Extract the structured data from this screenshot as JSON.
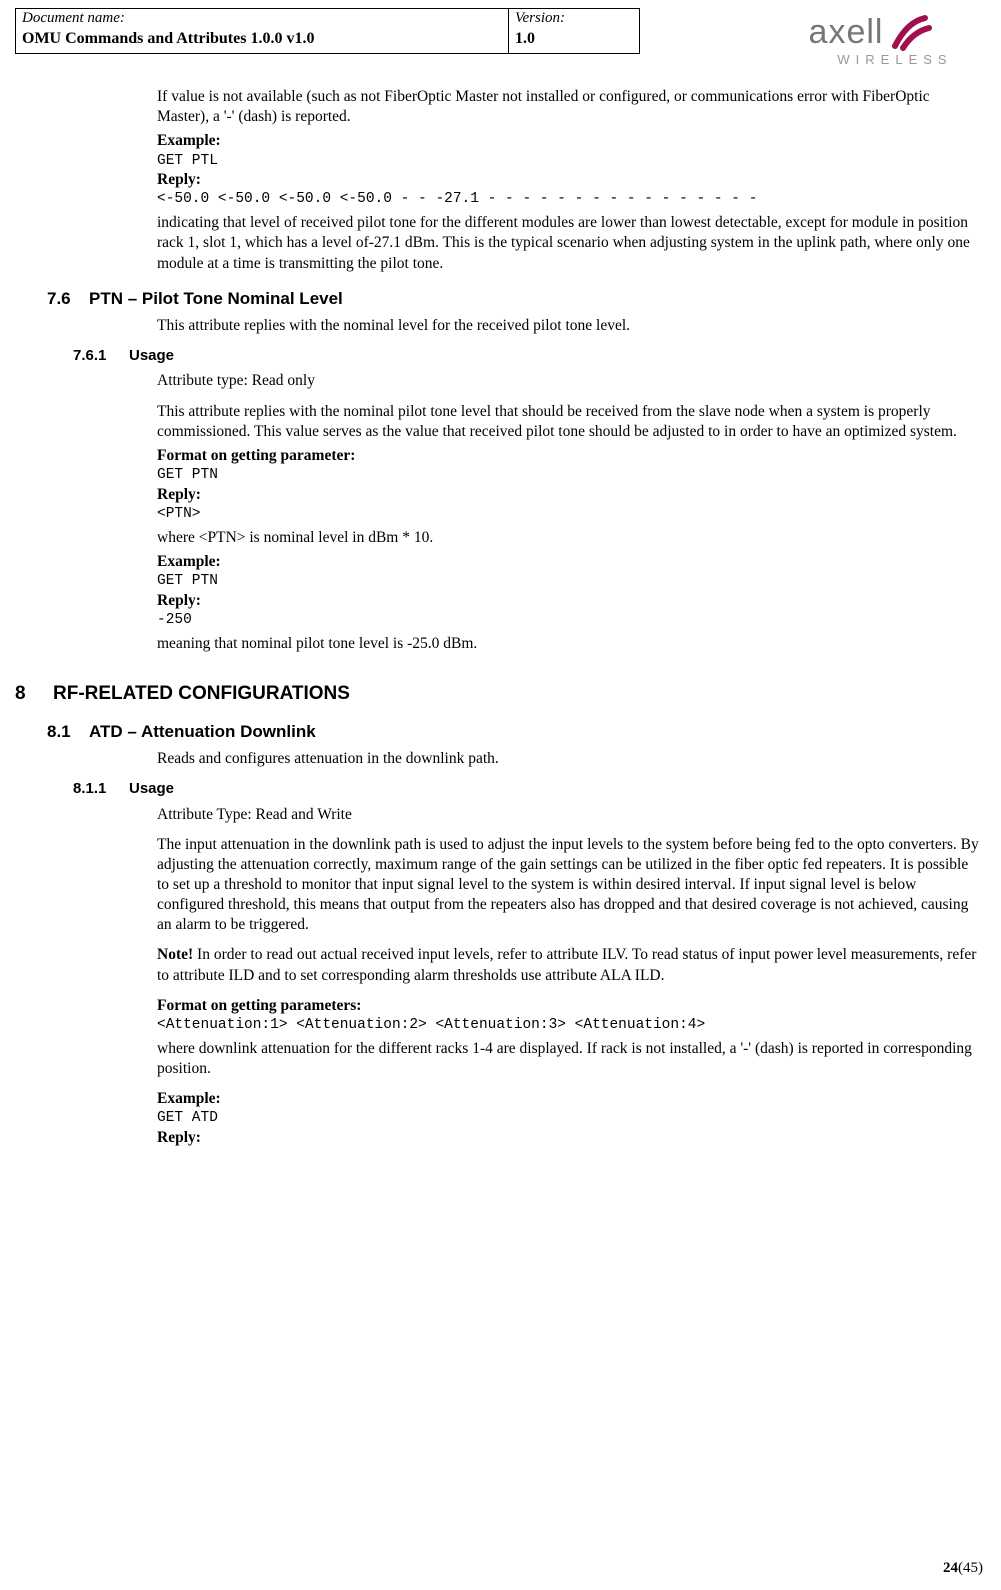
{
  "header": {
    "docname_label": "Document name:",
    "docname_value": "OMU Commands and Attributes 1.0.0 v1.0",
    "version_label": "Version:",
    "version_value": "1.0",
    "logo_name": "axell",
    "logo_sub": "WIRELESS"
  },
  "intro": {
    "p1": " If value is not available (such as not FiberOptic Master not installed or configured, or communications error with FiberOptic Master), a '-' (dash) is reported.",
    "ex_label": "Example:",
    "ex_code": "GET PTL",
    "reply_label": "Reply:",
    "reply_code": "<-50.0 <-50.0 <-50.0 <-50.0 - - -27.1 - - - - - - - - - - - - - - - -",
    "p2": "indicating that level of received pilot tone for the different modules are lower than lowest detectable, except for module in position rack 1, slot 1, which has a level of-27.1 dBm. This is the typical scenario when adjusting system in the uplink path, where only one module at a time is transmitting the pilot tone."
  },
  "s76": {
    "num": "7.6",
    "title": "PTN – Pilot Tone Nominal Level",
    "p1": "This attribute replies with the nominal level for the received pilot tone level."
  },
  "s761": {
    "num": "7.6.1",
    "title": "Usage",
    "p1": "Attribute type: Read only",
    "p2": "This attribute replies with the nominal pilot tone level that should be received from the slave node when a system is properly commissioned. This value serves as the value that received pilot tone should be adjusted to in order to have an optimized system.",
    "fmt_label": "Format on getting parameter:",
    "fmt_code": "GET PTN",
    "reply_label": "Reply:",
    "reply_code": "<PTN>",
    "p3": "where <PTN> is nominal level in dBm * 10.",
    "ex_label": "Example:",
    "ex_code": "GET PTN",
    "reply2_label": "Reply:",
    "reply2_code": "-250",
    "p4": "meaning that nominal pilot tone level is -25.0 dBm."
  },
  "s8": {
    "num": "8",
    "title": "RF-RELATED CONFIGURATIONS"
  },
  "s81": {
    "num": "8.1",
    "title": "ATD – Attenuation Downlink",
    "p1": "Reads and configures attenuation in the downlink path."
  },
  "s811": {
    "num": "8.1.1",
    "title": "Usage",
    "p1": "Attribute Type: Read and Write",
    "p2": "The input attenuation in the downlink path is used to adjust the input levels to the system before being fed to the opto converters. By adjusting the attenuation correctly, maximum range of the gain settings can be utilized in the fiber optic fed repeaters. It is possible to set up a threshold to monitor that input signal level to the system is within desired interval. If input signal level is below configured threshold, this means that output from the repeaters also has dropped and that desired coverage is not achieved, causing an alarm to be triggered.",
    "note_label": "Note!",
    "note_rest": " In order to read out actual received input levels, refer to attribute ILV. To read status of input power level measurements, refer to attribute ILD and to set corresponding alarm thresholds use attribute ALA ILD.",
    "fmt_label": "Format on getting parameters:",
    "fmt_code": "<Attenuation:1> <Attenuation:2> <Attenuation:3> <Attenuation:4>",
    "p3": "where downlink attenuation for the different racks 1-4 are displayed. If rack is not installed, a '-' (dash) is reported in corresponding position.",
    "ex_label": "Example:",
    "ex_code": "GET ATD",
    "reply_label": "Reply:"
  },
  "footer": {
    "page": "24",
    "total": "(45)"
  }
}
